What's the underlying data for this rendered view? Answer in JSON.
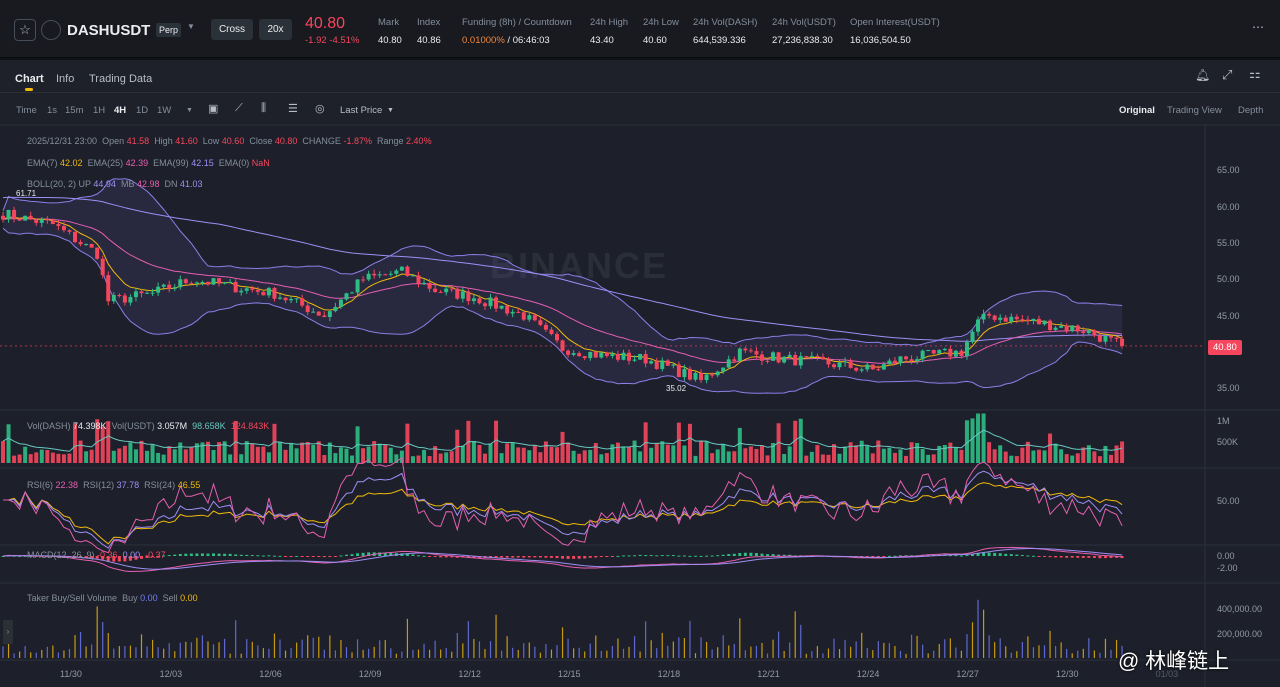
{
  "header": {
    "symbol": "DASHUSDT",
    "type": "Perp",
    "margin_mode": "Cross",
    "leverage": "20x",
    "last_price": "40.80",
    "change": "-1.92",
    "change_pct": "-4.51%",
    "stats": [
      {
        "label": "Mark",
        "value": "40.80"
      },
      {
        "label": "Index",
        "value": "40.86"
      },
      {
        "label": "Funding (8h) / Countdown",
        "value": "0.01000%",
        "value2": " / 06:46:03"
      },
      {
        "label": "24h High",
        "value": "43.40"
      },
      {
        "label": "24h Low",
        "value": "40.60"
      },
      {
        "label": "24h Vol(DASH)",
        "value": "644,539.336"
      },
      {
        "label": "24h Vol(USDT)",
        "value": "27,236,838.30"
      },
      {
        "label": "Open Interest(USDT)",
        "value": "16,036,504.50"
      }
    ]
  },
  "tabs": [
    "Chart",
    "Info",
    "Trading Data"
  ],
  "toolbar": {
    "intervals": [
      "Time",
      "1s",
      "15m",
      "1H",
      "4H",
      "1D",
      "1W"
    ],
    "active": "4H",
    "price_type": "Last Price",
    "views": [
      "Original",
      "Trading View",
      "Depth"
    ]
  },
  "legend": {
    "date": "2025/12/31 23:00",
    "open_l": "Open",
    "open": "41.58",
    "high_l": "High",
    "high": "41.60",
    "low_l": "Low",
    "low": "40.60",
    "close_l": "Close",
    "close": "40.80",
    "change_l": "CHANGE",
    "change": "-1.87%",
    "range_l": "Range",
    "range": "2.40%",
    "ema": [
      {
        "l": "EMA(7)",
        "v": "42.02"
      },
      {
        "l": "EMA(25)",
        "v": "42.39"
      },
      {
        "l": "EMA(99)",
        "v": "42.15"
      },
      {
        "l": "EMA(0)",
        "v": "NaN"
      }
    ],
    "boll": {
      "l": "BOLL(20, 2)",
      "up_l": "UP",
      "up": "44.94",
      "mb_l": "MB",
      "mb": "42.98",
      "dn_l": "DN",
      "dn": "41.03"
    },
    "vol": {
      "l1": "Vol(DASH)",
      "v1": "74.398K",
      "l2": "Vol(USDT)",
      "v2": "3.057M",
      "v3": "98.658K",
      "v4": "124.843K"
    },
    "rsi": [
      {
        "l": "RSI(6)",
        "v": "22.38"
      },
      {
        "l": "RSI(12)",
        "v": "37.78"
      },
      {
        "l": "RSI(24)",
        "v": "46.55"
      }
    ],
    "macd": {
      "l": "MACD(12, 26, 9)",
      "v1": "-0.36",
      "v2": "0.00",
      "v3": "-0.37"
    },
    "taker": {
      "l": "Taker Buy/Sell Volume",
      "buy_l": "Buy",
      "buy": "0.00",
      "sell_l": "Sell",
      "sell": "0.00"
    }
  },
  "chart_data": {
    "type": "candlestick",
    "price_axis": [
      "65.00",
      "60.00",
      "55.00",
      "50.00",
      "45.00",
      "40.00",
      "35.00"
    ],
    "ylim": [
      35,
      65
    ],
    "x_labels": [
      "11/30",
      "12/03",
      "12/06",
      "12/09",
      "12/12",
      "12/15",
      "12/18",
      "12/21",
      "12/24",
      "12/27",
      "12/30",
      "01/03"
    ],
    "max_label": "61.71",
    "min_label": "35.02",
    "current_label": "40.80",
    "vol_axis": [
      "1M",
      "500K"
    ],
    "rsi_axis": [
      "50.00"
    ],
    "macd_axis": [
      "0.00",
      "-2.00"
    ],
    "taker_axis": [
      "400,000.00",
      "200,000.00"
    ],
    "close_keypoints": [
      [
        0,
        59
      ],
      [
        9,
        57.5
      ],
      [
        17,
        53.5
      ],
      [
        19,
        47
      ],
      [
        27,
        48
      ],
      [
        34,
        50
      ],
      [
        41,
        49
      ],
      [
        49,
        48
      ],
      [
        58,
        45
      ],
      [
        65,
        50
      ],
      [
        72,
        51
      ],
      [
        78,
        48.5
      ],
      [
        85,
        47.5
      ],
      [
        94,
        45
      ],
      [
        101,
        40.5
      ],
      [
        108,
        39.5
      ],
      [
        116,
        39
      ],
      [
        123,
        37
      ],
      [
        126,
        36
      ],
      [
        133,
        40
      ],
      [
        141,
        39
      ],
      [
        148,
        38.5
      ],
      [
        157,
        37.5
      ],
      [
        162,
        39
      ],
      [
        173,
        40
      ],
      [
        176,
        44
      ],
      [
        178,
        45
      ],
      [
        187,
        44
      ],
      [
        195,
        43
      ],
      [
        202,
        40.8
      ]
    ],
    "colors": {
      "up": "#2ebd85",
      "down": "#f6465d",
      "ema7": "#f0b90b",
      "ema25": "#e45fb0",
      "ema99": "#9f8ef5",
      "boll": "#8b7fe8"
    }
  },
  "watermark": "@ 林峰链上",
  "logo": "BINANCE"
}
